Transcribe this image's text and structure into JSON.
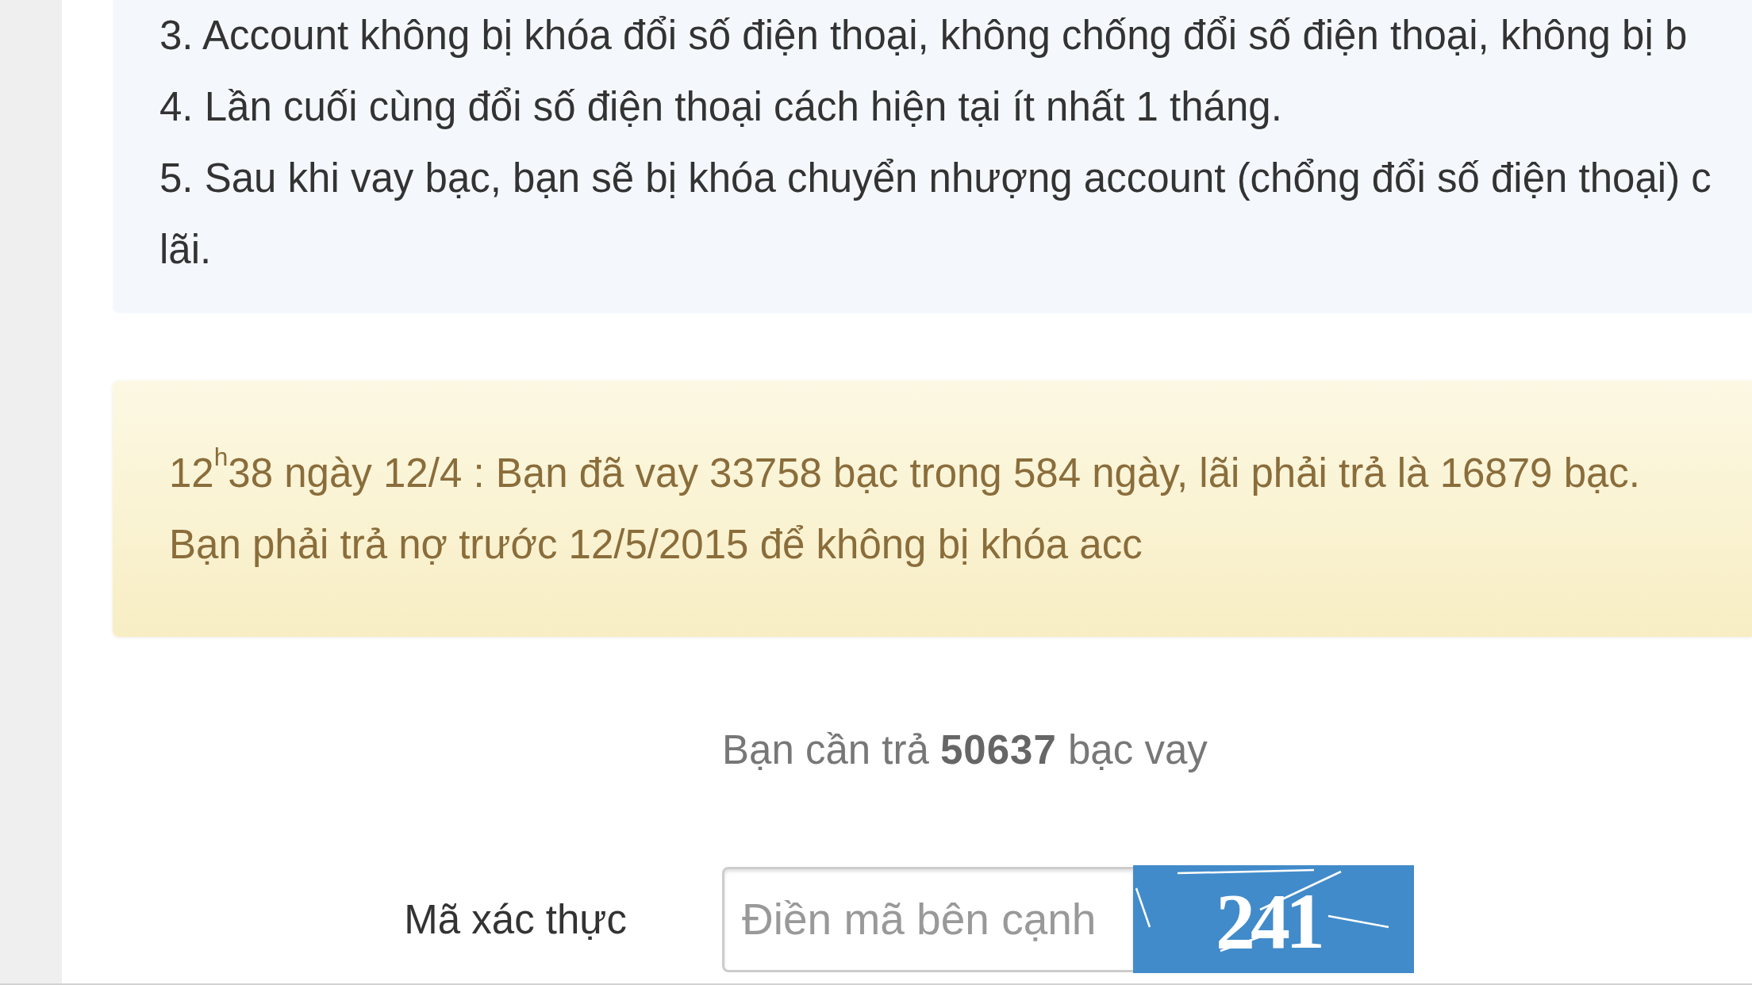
{
  "rules_box": {
    "items": [
      {
        "lines": [
          "3. Account không bị khóa đổi số điện thoại, không chống đổi số điện thoại, không bị b"
        ]
      },
      {
        "lines": [
          "4. Lần cuối cùng đổi số điện thoại cách hiện tại ít nhất 1 tháng."
        ]
      },
      {
        "lines": [
          "5. Sau khi vay bạc, bạn sẽ bị khóa chuyển nhượng account (chổng đổi số điện thoại) c",
          "lãi."
        ]
      }
    ]
  },
  "alert": {
    "lines": [
      "12$^{h}$38 ngày 12/4 : Bạn đã vay 33758 bạc trong 584 ngày, lãi phải trả là 16879 bạc.",
      "Bạn phải trả nợ trước 12/5/2015 để không bị khóa acc"
    ]
  },
  "payment": {
    "amount_text": "Bạn cần trả **50637** bạc vay"
  },
  "captcha_row": {
    "label": "Mã xác thực",
    "input": {
      "placeholder": "Điền mã bên cạnh"
    },
    "image_code": "241"
  }
}
